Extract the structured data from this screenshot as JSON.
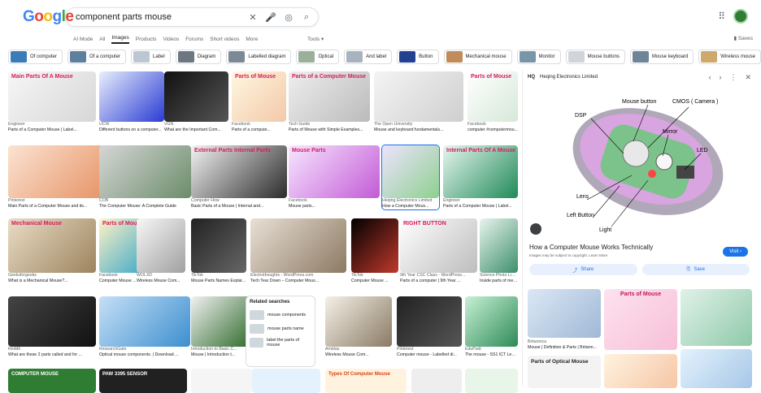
{
  "brand": {
    "logo": "Google"
  },
  "search": {
    "query": "component parts mouse"
  },
  "tabs": [
    "AI Mode",
    "All",
    "Images",
    "Products",
    "Videos",
    "Forums",
    "Short videos",
    "More"
  ],
  "active_tab": "Images",
  "tools_label": "Tools",
  "saves_label": "Saves",
  "chips": [
    "Of computer",
    "Of a computer",
    "Label",
    "Diagram",
    "Labelled diagram",
    "Optical",
    "And label",
    "Button",
    "Mechanical mouse",
    "Monitor",
    "Mouse buttons",
    "Mouse keyboard",
    "Wireless mouse"
  ],
  "results": [
    {
      "src": "Engineer",
      "title": "Parts of a Computer Mouse | Label...",
      "overlay": "Main Parts Of A Mouse"
    },
    {
      "src": "UCW",
      "title": "Different buttons on a computer..."
    },
    {
      "src": "VGN",
      "title": "What are the Important Com..."
    },
    {
      "src": "Facebook",
      "title": "Parts of a compute...",
      "overlay": "Parts of Mouse"
    },
    {
      "src": "Tech Guide",
      "title": "Parts of Mouse with Simple Examples...",
      "overlay": "Parts of a Computer Mouse"
    },
    {
      "src": "The Open University",
      "title": "Mouse and keyboard fundamentals..."
    },
    {
      "src": "Facebook",
      "title": "computer #computermou...",
      "overlay": "Parts of Mouse"
    },
    {
      "src": "Pinterest",
      "title": "Main Parts of a Computer Mouse and its..."
    },
    {
      "src": "COB",
      "title": "The Computer Mouse: A Complete Guide"
    },
    {
      "src": "Computer How",
      "title": "Basic Parts of a Mouse | Internal and...",
      "overlay": "External Parts   Internal Parts"
    },
    {
      "src": "Facebook",
      "title": "Mouse parts...",
      "overlay": "Mouse Parts"
    },
    {
      "src": "Heqing Electronics Limited",
      "title": "How a Computer Mous..."
    },
    {
      "src": "Engineer",
      "title": "Parts of a Computer Mouse | Label...",
      "overlay": "Internal Parts Of A Mouse"
    },
    {
      "src": "Geeksforgeeks",
      "title": "What is a Mechanical Mouse?...",
      "overlay": "Mechanical Mouse"
    },
    {
      "src": "Facebook",
      "title": "Computer Mouse ...",
      "overlay": "Parts of Mouse"
    },
    {
      "src": "WOLXD",
      "title": "Wireless Mouse Com..."
    },
    {
      "src": "TikTok",
      "title": "Mouse Parts Names Explained | Tik..."
    },
    {
      "src": "Electrothoughts - WordPress.com",
      "title": "Tech Tear Down – Computer Mous..."
    },
    {
      "src": "TikTok",
      "title": "Computer Mouse ..."
    },
    {
      "src": "9th Year CSC Class - WordPress...",
      "title": "Parts of a computer | 9th Year ...",
      "overlay": "RIGHT BUTTON"
    },
    {
      "src": "Science Photo Libr...",
      "title": "Inside parts of mec..."
    },
    {
      "src": "Reddit",
      "title": "What are these 2 parts called and for ..."
    },
    {
      "src": "ResearchGate",
      "title": "Optical mouse components. | Download ..."
    },
    {
      "src": "Introduction to Basic C...",
      "title": "Mouse | Introduction t..."
    },
    {
      "src": "Amidas",
      "title": "Wireless Mouse Com..."
    },
    {
      "src": "Pinterest",
      "title": "Computer mouse - Labelled di..."
    },
    {
      "src": "EduPadi",
      "title": "The mouse - SS1 ICT Lesson ..."
    }
  ],
  "related": {
    "heading": "Related searches",
    "items": [
      "mouse components",
      "mouse parts name",
      "label the parts of mouse"
    ]
  },
  "bottom_row": [
    "COMPUTER MOUSE",
    "PAW 3395 SENSOR",
    "",
    "",
    "Types Of Computer Mouse",
    "",
    ""
  ],
  "panel": {
    "source": "Heqing Electronics Limited",
    "source_badge": "HQ",
    "title": "How a Computer Mouse Works Technically",
    "visit": "Visit",
    "copyright": "Images may be subject to copyright. Learn More",
    "share": "Share",
    "save": "Save",
    "labels": [
      "Mouse button",
      "CMOS ( Camera )",
      "DSP",
      "Mirror",
      "LED",
      "Lens",
      "Left Button",
      "Light"
    ],
    "similar": [
      {
        "src": "Britannica",
        "title": "Mouse | Definition & Parts | Britann..."
      },
      {
        "src": "",
        "title": "",
        "overlay": "Parts of Mouse"
      },
      {
        "src": "",
        "title": ""
      }
    ],
    "similar_bottom_overlay": "Parts of Optical Mouse"
  }
}
